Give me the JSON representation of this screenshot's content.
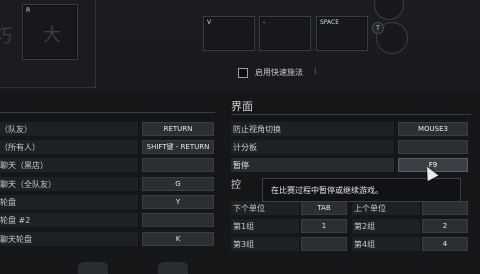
{
  "top": {
    "keys": [
      {
        "id": "r",
        "label": "R"
      },
      {
        "id": "v",
        "label": "V"
      },
      {
        "id": "dash",
        "label": "-"
      },
      {
        "id": "space",
        "label": "SPACE"
      }
    ],
    "glyph_left": "巧",
    "glyph_big": "大",
    "badge_label": "T",
    "quick_cast_label": "启用快速施法"
  },
  "left_panel": {
    "rows": [
      {
        "label": "（队友）",
        "key": "RETURN"
      },
      {
        "label": "（所有人）",
        "key": "SHIFT键 - RETURN"
      },
      {
        "label": "聊天（黑店）",
        "key": ""
      },
      {
        "label": "聊天（全队友）",
        "key": "G"
      },
      {
        "label": "轮盘",
        "key": "Y"
      },
      {
        "label": "轮盘 #2",
        "key": ""
      },
      {
        "label": "聊天轮盘",
        "key": "K"
      }
    ]
  },
  "right_panel": {
    "title": "界面",
    "rows": [
      {
        "label": "防止视角切换",
        "key": "MOUSE3"
      },
      {
        "label": "计分板",
        "key": ""
      },
      {
        "label": "暂停",
        "key": "F9"
      }
    ],
    "partial_section": "控",
    "groups": [
      {
        "left_label": "下个单位",
        "left_key": "TAB",
        "right_label": "上个单位",
        "right_key": ""
      },
      {
        "left_label": "第1组",
        "left_key": "1",
        "right_label": "第2组",
        "right_key": "2"
      },
      {
        "left_label": "第3组",
        "left_key": "",
        "right_label": "第4组",
        "right_key": "4"
      }
    ]
  },
  "tooltip": {
    "text": "在比赛过程中暂停或继续游戏。"
  }
}
